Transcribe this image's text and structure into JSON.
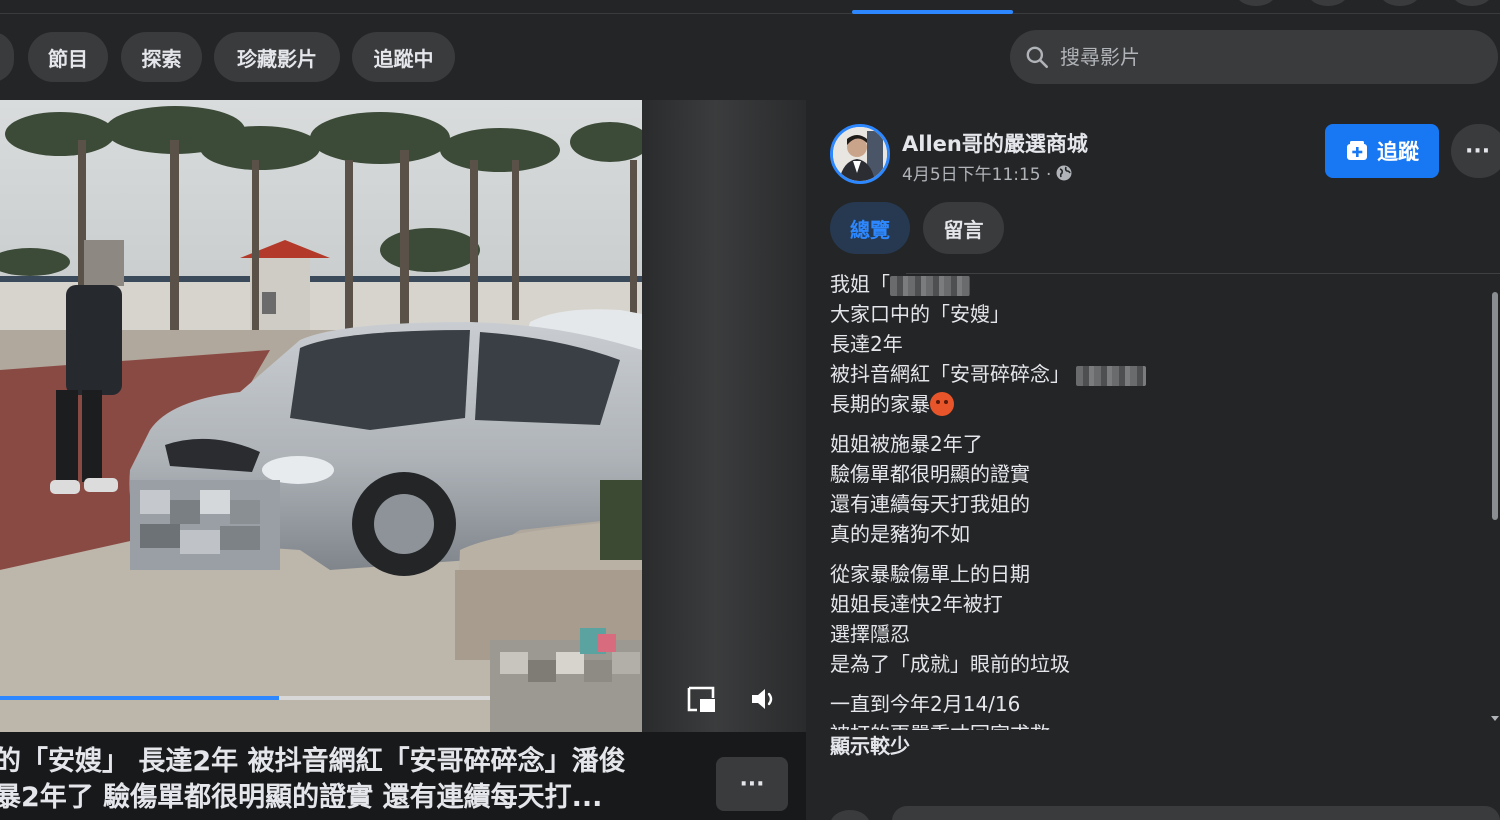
{
  "filter_chips": [
    {
      "label": ""
    },
    {
      "label": "節目"
    },
    {
      "label": "探索"
    },
    {
      "label": "珍藏影片"
    },
    {
      "label": "追蹤中"
    }
  ],
  "search": {
    "placeholder": "搜尋影片",
    "icon": "search-icon"
  },
  "video": {
    "progress_fraction": 0.57,
    "caption_line1": "的「安嫂」 長達2年 被抖音網紅「安哥碎碎念」潘俊",
    "caption_line2": "暴2年了 驗傷單都很明顯的證實 還有連續每天打..."
  },
  "post": {
    "page_name": "Allen哥的嚴選商城",
    "timestamp": "4月5日下午11:15 ·",
    "privacy_icon": "globe-icon",
    "follow_label": "追蹤",
    "tabs": [
      {
        "label": "總覽",
        "active": true
      },
      {
        "label": "留言",
        "active": false
      }
    ],
    "body": {
      "line1_prefix": "我姐「",
      "line2": "大家口中的「安嫂」",
      "line3": "長達2年",
      "line4": "被抖音網紅「安哥碎碎念」",
      "line5": "長期的家暴",
      "para2": [
        "姐姐被施暴2年了",
        "驗傷單都很明顯的證實",
        "還有連續每天打我姐的",
        "真的是豬狗不如"
      ],
      "para3": [
        "從家暴驗傷單上的日期",
        "姐姐長達快2年被打",
        "選擇隱忍",
        "是為了「成就」眼前的垃圾"
      ],
      "para4": [
        "一直到今年2月14/16",
        "被打的更嚴重才回家求救"
      ]
    },
    "show_less_label": "顯示較少"
  },
  "colors": {
    "accent": "#2d88ff",
    "follow": "#1877f2",
    "bg": "#18191a",
    "surface": "#242526"
  }
}
